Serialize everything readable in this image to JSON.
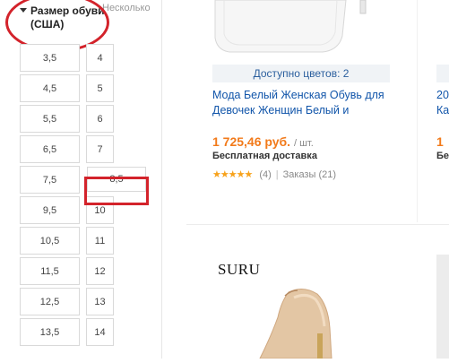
{
  "filter": {
    "title": "Размер обуви (США)",
    "more_label": "Несколько",
    "sizes_left": [
      "3,5",
      "4,5",
      "5,5",
      "6,5",
      "7,5",
      "9,5",
      "10,5",
      "11,5",
      "12,5",
      "13,5"
    ],
    "sizes_right": [
      "4",
      "5",
      "6",
      "7",
      "8,5",
      "10",
      "11",
      "12",
      "13",
      "14"
    ]
  },
  "product1": {
    "colors_available": "Доступно цветов: 2",
    "title": "Мода Белый Женская Обувь для Девочек Женщин Белый и",
    "price": "1 725,46 руб.",
    "price_unit": "/ шт.",
    "shipping": "Бесплатная доставка",
    "stars": "★★★★★",
    "reviews": "(4)",
    "orders": "Заказы (21)"
  },
  "product_partial": {
    "title_line1": "20",
    "title_line2": "Ка",
    "price": "1",
    "shipping": "Бе"
  },
  "product2": {
    "brand": "SURU"
  },
  "colors": {
    "accent_orange": "#f27a1a",
    "link_blue": "#1155aa",
    "annotation_red": "#d3232b"
  }
}
